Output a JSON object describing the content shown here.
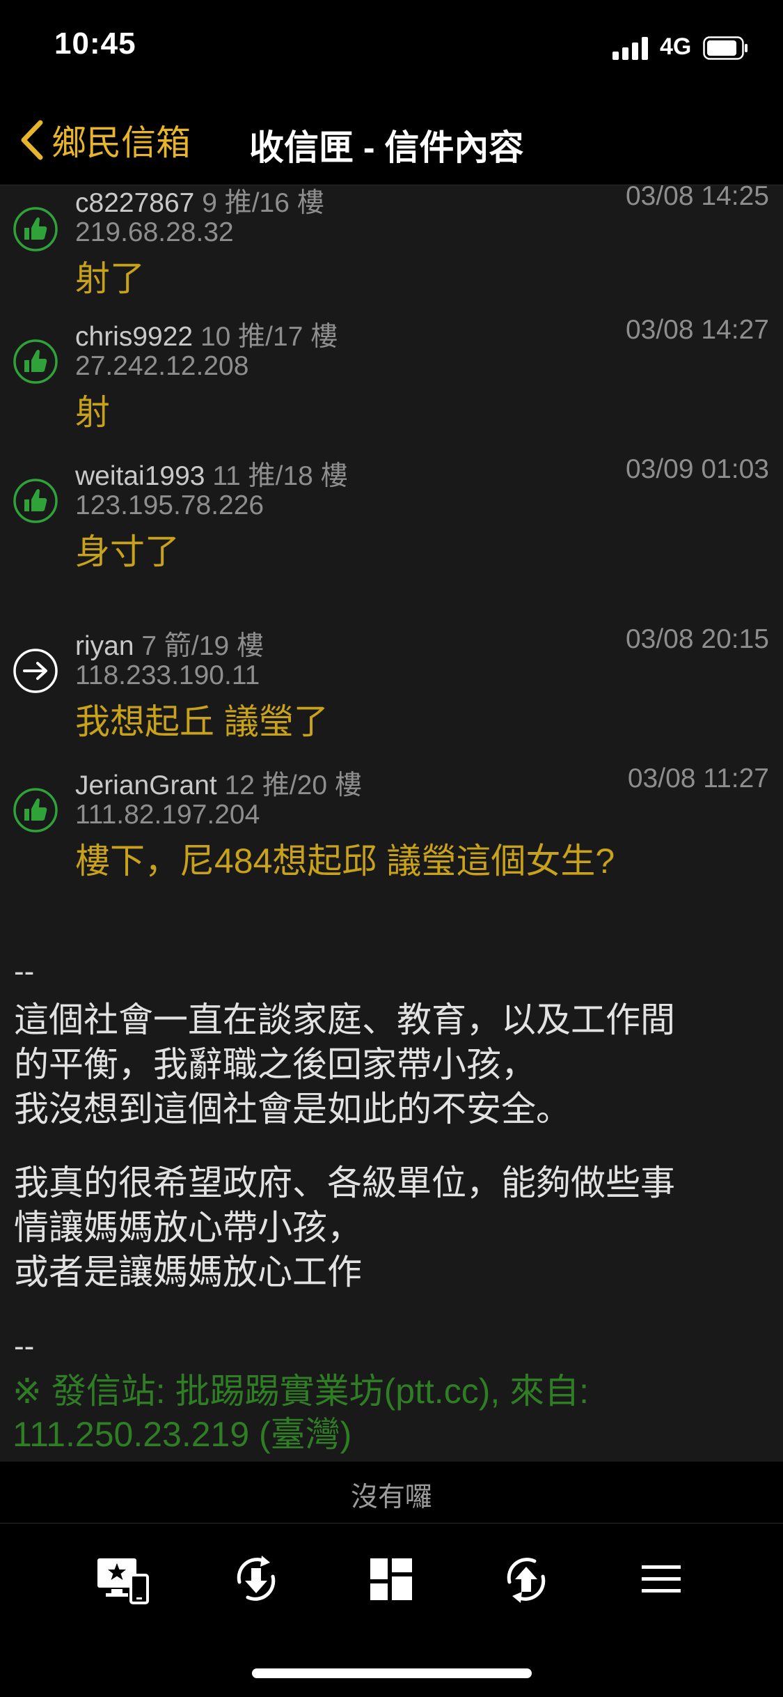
{
  "status": {
    "time": "10:45",
    "network": "4G"
  },
  "nav": {
    "back_label": "鄉民信箱",
    "title": "收信匣 - 信件內容"
  },
  "comments": [
    {
      "user": "c8227867",
      "meta": "9 推/16 樓",
      "time": "03/08 14:25",
      "ip": "219.68.28.32",
      "text": "射了",
      "type": "push"
    },
    {
      "user": "chris9922",
      "meta": "10 推/17 樓",
      "time": "03/08 14:27",
      "ip": "27.242.12.208",
      "text": "射",
      "type": "push"
    },
    {
      "user": "weitai1993",
      "meta": "11 推/18 樓",
      "time": "03/09 01:03",
      "ip": "123.195.78.226",
      "text": "身寸了",
      "type": "push"
    },
    {
      "user": "riyan",
      "meta": "7 箭/19 樓",
      "time": "03/08 20:15",
      "ip": "118.233.190.11",
      "text": "我想起丘 議瑩了",
      "type": "arrow"
    },
    {
      "user": "JerianGrant",
      "meta": "12 推/20 樓",
      "time": "03/08 11:27",
      "ip": "111.82.197.204",
      "text": "樓下，尼484想起邱  議瑩這個女生?",
      "type": "push"
    }
  ],
  "signature": {
    "separator": "--",
    "paragraph1": "這個社會一直在談家庭、教育，以及工作間\n的平衡，我辭職之後回家帶小孩，\n我沒想到這個社會是如此的不安全。",
    "paragraph2": "我真的很希望政府、各級單位，能夠做些事\n情讓媽媽放心帶小孩，\n或者是讓媽媽放心工作",
    "separator2": "--",
    "origin": "※ 發信站: 批踢踢實業坊(ptt.cc), 來自:\n111.250.23.219 (臺灣)"
  },
  "footer_notice": "沒有囉",
  "toolbar": {
    "buttons": [
      {
        "icon": "screen-star-icon"
      },
      {
        "icon": "refresh-down-icon"
      },
      {
        "icon": "dashboard-icon"
      },
      {
        "icon": "refresh-up-icon"
      },
      {
        "icon": "menu-icon"
      }
    ]
  },
  "colors": {
    "accent": "#e7b52c",
    "comment_text": "#c8a21a",
    "push_icon": "#2fa23a",
    "origin_text": "#2f7d24",
    "content_bg": "#191919"
  }
}
